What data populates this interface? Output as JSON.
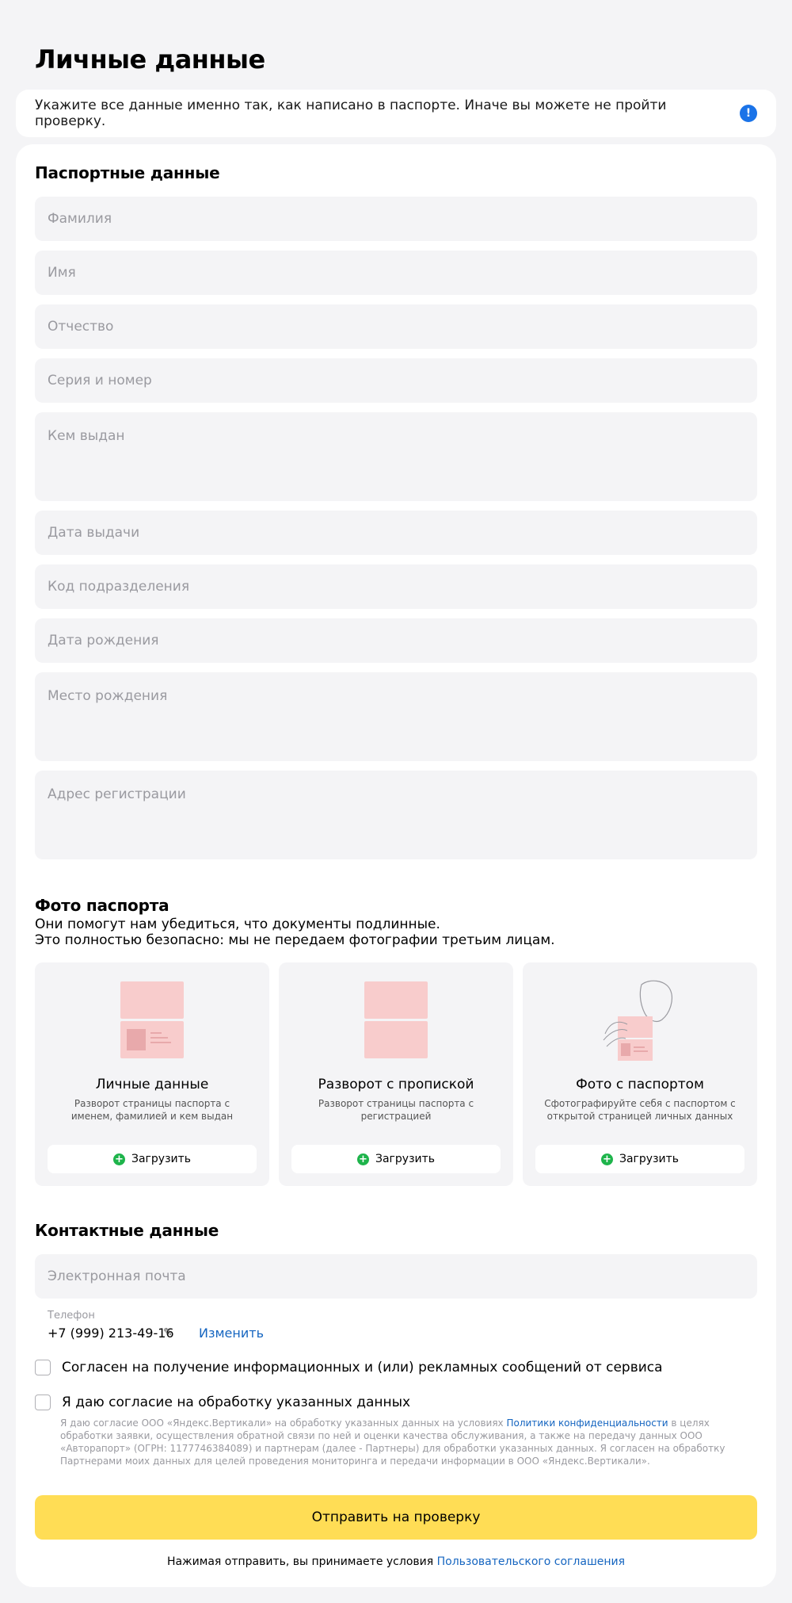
{
  "page_title": "Личные данные",
  "notice": {
    "text": "Укажите все данные именно так, как написано в паспорте. Иначе вы можете не пройти проверку.",
    "icon": "info-icon",
    "icon_glyph": "!",
    "icon_color": "#1a73e8"
  },
  "passport": {
    "title": "Паспортные данные",
    "fields": [
      {
        "placeholder": "Фамилия"
      },
      {
        "placeholder": "Имя"
      },
      {
        "placeholder": "Отчество"
      },
      {
        "placeholder": "Серия и номер"
      },
      {
        "placeholder": "Кем выдан"
      },
      {
        "placeholder": "Дата выдачи"
      },
      {
        "placeholder": "Код подразделения"
      },
      {
        "placeholder": "Дата рождения"
      },
      {
        "placeholder": "Место рождения"
      },
      {
        "placeholder": "Адрес регистрации"
      }
    ]
  },
  "photos": {
    "title": "Фото паспорта",
    "subtitle_line1": "Они помогут нам убедиться, что документы подлинные.",
    "subtitle_line2": "Это полностью безопасно: мы не передаем фотографии третьим лицам.",
    "tiles": [
      {
        "title": "Личные данные",
        "desc": "Разворот страницы паспорта с именем, фамилией и кем выдан",
        "button": "Загрузить"
      },
      {
        "title": "Разворот с пропиской",
        "desc": "Разворот страницы паспорта с регистрацией",
        "button": "Загрузить"
      },
      {
        "title": "Фото с паспортом",
        "desc": "Сфотографируйте себя с паспортом с открытой страницей личных данных",
        "button": "Загрузить"
      }
    ]
  },
  "contacts": {
    "title": "Контактные данные",
    "email_placeholder": "Электронная почта",
    "phone_label": "Телефон",
    "phone_value": "+7 (999) 213-49-16",
    "change_label": "Изменить"
  },
  "consents": {
    "marketing": "Согласен на получение информационных и (или) рекламных сообщений от сервиса",
    "processing": "Я даю согласие на обработку указанных данных",
    "legal_before": "Я даю согласие ООО «Яндекс.Вертикали» на обработку указанных данных на условиях ",
    "legal_link": "Политики конфиденциальности",
    "legal_after": " в целях обработки заявки, осуществления обратной связи по ней и оценки качества обслуживания, а также на передачу данных ООО «Авторапорт» (ОГРН: 1177746384089) и партнерам (далее - Партнеры) для обработки указанных данных. Я согласен на обработку Партнерами моих данных для целей проведения мониторинга и передачи информации в ООО «Яндекс.Вертикали»."
  },
  "submit_label": "Отправить на проверку",
  "footer": {
    "text": "Нажимая отправить, вы принимаете условия ",
    "link": "Пользовательского соглашения"
  },
  "colors": {
    "background": "#f4f4f6",
    "accent_button": "#ffdd55",
    "link": "#1565c0",
    "upload_plus": "#1eb44b",
    "passport_illustration": "#f8cccc"
  }
}
